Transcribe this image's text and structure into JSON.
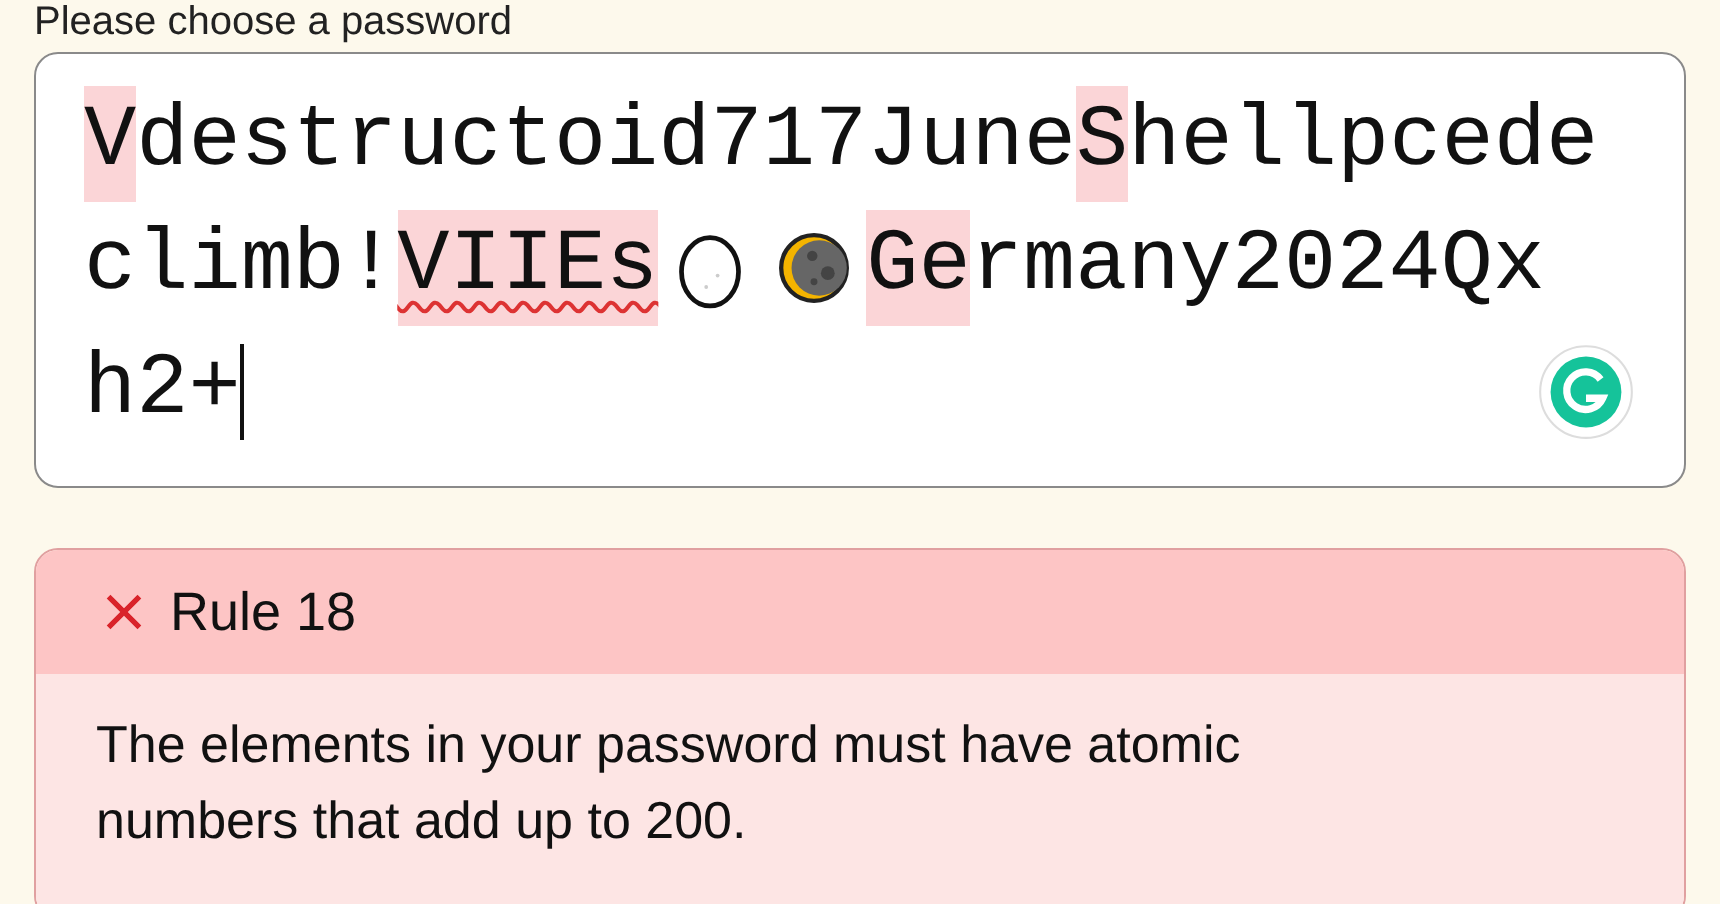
{
  "prompt": "Please choose a password",
  "password": {
    "lines": [
      [
        {
          "kind": "text",
          "text": "V",
          "highlighted": true,
          "misspelled": false
        },
        {
          "kind": "text",
          "text": "destructoid717June",
          "highlighted": false,
          "misspelled": false
        },
        {
          "kind": "text",
          "text": "S",
          "highlighted": true,
          "misspelled": false
        },
        {
          "kind": "text",
          "text": "hellpcede",
          "highlighted": false,
          "misspelled": false
        }
      ],
      [
        {
          "kind": "text",
          "text": "climb!",
          "highlighted": false,
          "misspelled": false
        },
        {
          "kind": "text",
          "text": "VIIEs",
          "highlighted": true,
          "misspelled": true
        },
        {
          "kind": "egg"
        },
        {
          "kind": "moon"
        },
        {
          "kind": "text",
          "text": "Ge",
          "highlighted": true,
          "misspelled": false
        },
        {
          "kind": "text",
          "text": "rmany2024Qx",
          "highlighted": false,
          "misspelled": false
        }
      ],
      [
        {
          "kind": "text",
          "text": "h2+",
          "highlighted": false,
          "misspelled": false
        }
      ]
    ]
  },
  "rule": {
    "title": "Rule 18",
    "passed": false,
    "text": "The elements in your password must have atomic numbers that add up to 200."
  }
}
